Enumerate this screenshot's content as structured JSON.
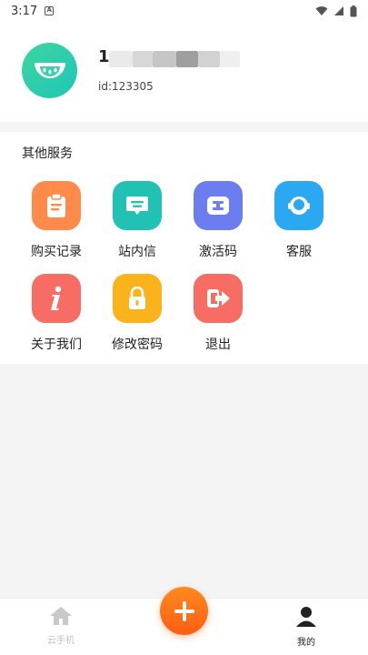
{
  "status_bar": {
    "time": "3:17"
  },
  "profile": {
    "name_visible": "1",
    "user_id": "id:123305"
  },
  "services": {
    "title": "其他服务",
    "items": [
      {
        "label": "购买记录",
        "icon": "clipboard-icon",
        "color": "#ff8a4a"
      },
      {
        "label": "站内信",
        "icon": "message-icon",
        "color": "#21c2b3"
      },
      {
        "label": "激活码",
        "icon": "code-icon",
        "color": "#6c7df0"
      },
      {
        "label": "客服",
        "icon": "headset-icon",
        "color": "#2aa8f2"
      },
      {
        "label": "关于我们",
        "icon": "info-icon",
        "color": "#f76c63"
      },
      {
        "label": "修改密码",
        "icon": "lock-icon",
        "color": "#fbb31c"
      },
      {
        "label": "退出",
        "icon": "logout-icon",
        "color": "#f76c63"
      }
    ]
  },
  "bottom_nav": {
    "items": [
      {
        "label": "云手机",
        "icon": "home-icon",
        "active": false
      },
      {
        "label": "我的",
        "icon": "user-icon",
        "active": true
      }
    ],
    "fab_icon": "plus-icon"
  },
  "colors": {
    "accent": "#ff6a14",
    "background": "#f4f4f4"
  }
}
